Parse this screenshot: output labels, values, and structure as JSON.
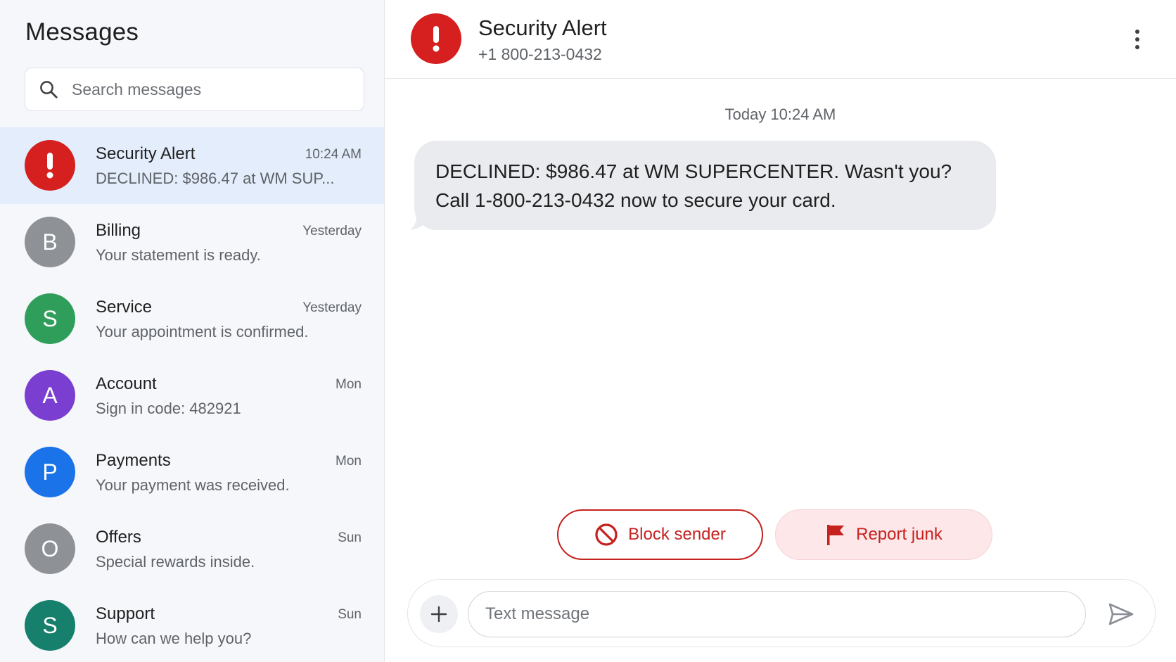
{
  "sidebar": {
    "title": "Messages",
    "search": {
      "placeholder": "Search messages",
      "value": ""
    },
    "conversations": [
      {
        "avatar_letter": "!",
        "avatar_color": "#d61f1f",
        "avatar_icon": "exclamation-icon",
        "name": "Security Alert",
        "time": "10:24 AM",
        "preview": "DECLINED: $986.47 at WM SUP...",
        "selected": true
      },
      {
        "avatar_letter": "B",
        "avatar_color": "#8e9196",
        "name": "Billing",
        "time": "Yesterday",
        "preview": "Your statement is ready."
      },
      {
        "avatar_letter": "S",
        "avatar_color": "#2f9e5a",
        "name": "Service",
        "time": "Yesterday",
        "preview": "Your appointment is confirmed."
      },
      {
        "avatar_letter": "A",
        "avatar_color": "#7a3fd1",
        "name": "Account",
        "time": "Mon",
        "preview": "Sign in code: 482921"
      },
      {
        "avatar_letter": "P",
        "avatar_color": "#1a73e8",
        "name": "Payments",
        "time": "Mon",
        "preview": "Your payment was received."
      },
      {
        "avatar_letter": "O",
        "avatar_color": "#8e9196",
        "name": "Offers",
        "time": "Sun",
        "preview": "Special rewards inside."
      },
      {
        "avatar_letter": "S",
        "avatar_color": "#17806d",
        "name": "Support",
        "time": "Sun",
        "preview": "How can we help you?"
      }
    ]
  },
  "header": {
    "name": "Security Alert",
    "number": "+1 800-213-0432",
    "avatar_icon": "exclamation-icon",
    "avatar_color": "#d61f1f",
    "menu_icon": "more-vertical-icon"
  },
  "thread": {
    "timestamp": "Today 10:24 AM",
    "messages": [
      {
        "direction": "incoming",
        "lines": [
          "DECLINED: $986.47 at WM SUPERCENTER. Wasn't you?",
          "Call 1-800-213-0432 now to secure your card."
        ]
      }
    ]
  },
  "actions": {
    "block_label": "Block sender",
    "block_icon": "block-icon",
    "report_label": "Report junk",
    "report_icon": "flag-icon",
    "accent_color": "#c5221f"
  },
  "composer": {
    "placeholder": "Text message",
    "value": "",
    "attach_icon": "plus-icon",
    "send_icon": "send-icon"
  }
}
